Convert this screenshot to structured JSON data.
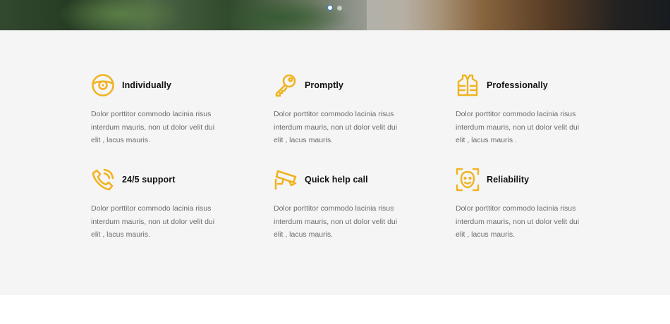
{
  "colors": {
    "accent": "#f0b320",
    "section_bg": "#f5f5f5",
    "title": "#111111",
    "text": "#6b6b6b"
  },
  "slider": {
    "dots": 2,
    "active_index": 0
  },
  "features": [
    {
      "title": "Individually",
      "icon": "disc-icon",
      "text": "Dolor porttitor commodo lacinia risus interdum mauris, non ut dolor velit dui elit , lacus mauris."
    },
    {
      "title": "Promptly",
      "icon": "key-icon",
      "text": "Dolor porttitor commodo lacinia risus interdum mauris, non ut dolor velit dui elit , lacus mauris."
    },
    {
      "title": "Professionally",
      "icon": "safety-vest-icon",
      "text": "Dolor porttitor commodo lacinia risus interdum mauris, non ut dolor velit dui elit , lacus mauris ."
    },
    {
      "title": "24/5 support",
      "icon": "phone-icon",
      "text": "Dolor porttitor commodo lacinia risus interdum mauris, non ut dolor velit dui elit , lacus mauris."
    },
    {
      "title": "Quick help call",
      "icon": "security-camera-icon",
      "text": "Dolor porttitor commodo lacinia risus interdum mauris, non ut dolor velit dui elit , lacus mauris."
    },
    {
      "title": "Reliability",
      "icon": "face-scan-icon",
      "text": "Dolor porttitor commodo lacinia risus interdum mauris, non ut dolor velit dui elit , lacus mauris."
    }
  ]
}
